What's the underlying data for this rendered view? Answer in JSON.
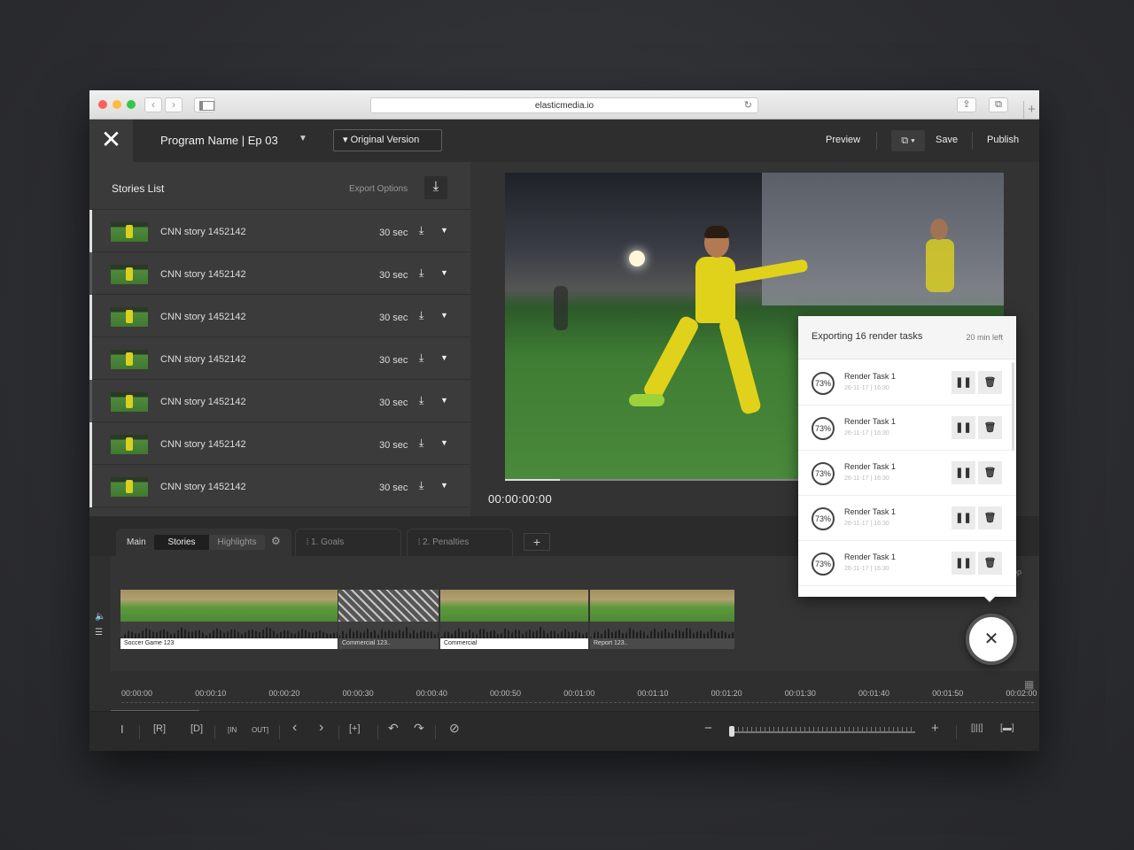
{
  "browser": {
    "url": "elasticmedia.io",
    "back_icon": "‹",
    "forward_icon": "›",
    "reload_icon": "↻",
    "share_icon": "⇪",
    "tabs_icon": "⧉",
    "newtab_icon": "+"
  },
  "header": {
    "close_icon": "✕",
    "program_name": "Program Name | Ep 03",
    "program_caret": "▼",
    "version_label": "▾  Original Version",
    "preview": "Preview",
    "duplicate_icon": "⧉ ▾",
    "save": "Save",
    "publish": "Publish"
  },
  "stories": {
    "title": "Stories List",
    "export_options": "Export Options",
    "export_icon": "⤓",
    "items": [
      {
        "name": "CNN story 1452142",
        "duration": "30 sec",
        "marker": "bright"
      },
      {
        "name": "CNN story 1452142",
        "duration": "30 sec",
        "marker": "dim"
      },
      {
        "name": "CNN story 1452142",
        "duration": "30 sec",
        "marker": "bright"
      },
      {
        "name": "CNN story 1452142",
        "duration": "30 sec",
        "marker": "bright"
      },
      {
        "name": "CNN story 1452142",
        "duration": "30 sec",
        "marker": "dim"
      },
      {
        "name": "CNN story 1452142",
        "duration": "30 sec",
        "marker": "bright"
      },
      {
        "name": "CNN story 1452142",
        "duration": "30 sec",
        "marker": "bright"
      }
    ],
    "download_icon": "⤓",
    "caret_icon": "▼"
  },
  "player": {
    "timecode": "00:00:00:00",
    "prev_icon": "⏮",
    "play_icon": "▶",
    "next_icon": "⏭"
  },
  "timeline": {
    "tab_main": "Main",
    "seg_stories": "Stories",
    "seg_highlights": "Highlights",
    "gear_icon": "⚙",
    "tabs": [
      "⦙  1. Goals",
      "⦙  2. Penalties"
    ],
    "add_tab": "+",
    "volume_icon": "🔈",
    "track_icon": "☰",
    "clips": [
      {
        "label": "Soccer Game 123"
      },
      {
        "label": "Commercial 123.."
      },
      {
        "label": "Commercial"
      },
      {
        "label": "Report 123.."
      }
    ],
    "ruler": [
      "00:00:00",
      "00:00:10",
      "00:00:20",
      "00:00:30",
      "00:00:40",
      "00:00:50",
      "00:01:00",
      "00:01:10",
      "00:01:20",
      "00:01:30",
      "00:01:40",
      "00:01:50",
      "00:02:00"
    ],
    "grid_icon": "▦",
    "partial_text": "pp"
  },
  "toolbar": {
    "text_tool": "I",
    "r_tool": "[R]",
    "d_tool": "[D]",
    "in_tool": "[IN",
    "out_tool": "OUT]",
    "left_tool": "‹",
    "right_tool": "›",
    "add_tool": "[+]",
    "undo_tool": "↶",
    "redo_tool": "↷",
    "hide_tool": "⊘",
    "zoom_out": "−",
    "zoom_in": "+",
    "fit_tool": "[|||]",
    "full_tool": "[▬]"
  },
  "export_panel": {
    "title": "Exporting 16 render tasks",
    "time_left": "20 min left",
    "tasks": [
      {
        "name": "Render Task 1",
        "date": "26-11-17 | 16:30",
        "progress": "73%"
      },
      {
        "name": "Render Task 1",
        "date": "26-11-17 | 16:30",
        "progress": "73%"
      },
      {
        "name": "Render Task 1",
        "date": "26-11-17 | 16:30",
        "progress": "73%"
      },
      {
        "name": "Render Task 1",
        "date": "26-11-17 | 16:30",
        "progress": "73%"
      },
      {
        "name": "Render Task 1",
        "date": "26-11-17 | 16:30",
        "progress": "73%"
      }
    ],
    "pause_icon": "❚❚",
    "delete_icon": "🗑",
    "close_icon": "✕"
  }
}
